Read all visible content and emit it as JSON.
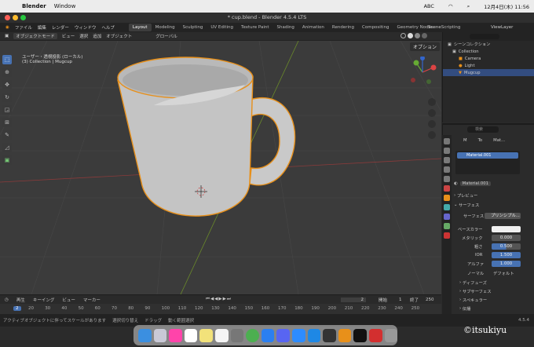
{
  "mac_menu": {
    "app": "Blender",
    "items": [
      "Window"
    ],
    "date_time": "12月4日(木) 11:56",
    "abc": "ABC"
  },
  "window": {
    "title": "* cup.blend - Blender 4.5.4 LTS"
  },
  "top_menu": [
    "ファイル",
    "編集",
    "レンダー",
    "ウィンドウ",
    "ヘルプ"
  ],
  "workspaces": [
    "Layout",
    "Modeling",
    "Sculpting",
    "UV Editing",
    "Texture Paint",
    "Shading",
    "Animation",
    "Rendering",
    "Compositing",
    "Geometry Nodes",
    "Scripting"
  ],
  "scene": "Scene",
  "view_layer": "ViewLayer",
  "header3d": {
    "mode": "オブジェクトモード",
    "menus": [
      "ビュー",
      "選択",
      "追加",
      "オブジェクト"
    ],
    "orientation": "グローバル",
    "options": "オプション"
  },
  "viewport": {
    "line1": "ユーザー・透視投影 (ローカル)",
    "line2": "(3) Collection | Mugcup"
  },
  "outliner": {
    "root": "シーンコレクション",
    "collection": "Collection",
    "items": [
      "Camera",
      "Light",
      "Mugcup"
    ]
  },
  "props": {
    "search_placeholder": "検索",
    "crumb": [
      "M",
      "To",
      "Mat..."
    ],
    "slot": "Material.001",
    "material_name": "Material.001",
    "preview": "プレビュー",
    "surface_panel": "サーフェス",
    "surface_label": "サーフェス",
    "surface_value": "プリンシプル...",
    "rows": [
      {
        "label": "ベースカラー",
        "value": ""
      },
      {
        "label": "メタリック",
        "value": "0.000"
      },
      {
        "label": "粗さ",
        "value": "0.500"
      },
      {
        "label": "IOR",
        "value": "1.500"
      },
      {
        "label": "アルファ",
        "value": "1.000"
      },
      {
        "label": "ノーマル",
        "value": "デフォルト"
      }
    ],
    "subpanels": [
      "ディフューズ",
      "サブサーフェス",
      "スペキュラー",
      "伝播"
    ]
  },
  "timeline": {
    "menus": [
      "再生",
      "キーイング",
      "ビュー",
      "マーカー"
    ],
    "current": "2",
    "start_label": "開始",
    "start": "1",
    "end_label": "終了",
    "end": "250"
  },
  "ruler": [
    "20",
    "30",
    "40",
    "50",
    "60",
    "70",
    "80",
    "90",
    "100",
    "110",
    "120",
    "130",
    "140",
    "150",
    "160",
    "170",
    "180",
    "190",
    "200",
    "210",
    "220",
    "230",
    "240",
    "250"
  ],
  "ruler_cur": "2",
  "status": {
    "left": "アクティブオブジェクトに伴ってスケールがあります",
    "mid1": "選択切り替え",
    "mid2": "ドラッグ",
    "mid3": "動く範囲選択",
    "version": "4.5.4"
  },
  "watermark": "©itsukiyu",
  "colors": {
    "accent": "#4772b3",
    "orange": "#e8901a"
  }
}
